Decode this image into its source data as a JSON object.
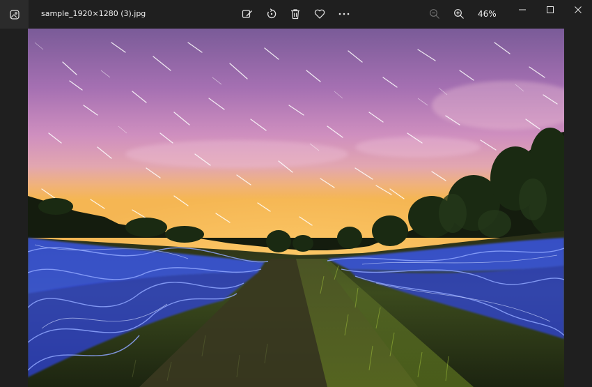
{
  "window": {
    "file_name": "sample_1920×1280 (3).jpg",
    "zoom": "46%"
  },
  "toolbar": {
    "icons": [
      "edit-image-icon",
      "rotate-icon",
      "delete-icon",
      "favorite-heart-icon",
      "more-options-icon"
    ],
    "zoom_controls": [
      "zoom-out-icon",
      "zoom-in-icon"
    ]
  },
  "window_controls": [
    "minimize-icon",
    "maximize-icon",
    "close-icon"
  ],
  "photo": {
    "subject": "star trails over field with blue light painting",
    "colors": {
      "sky_top": "#7b5a9a",
      "sky_mid": "#c88bc0",
      "horizon": "#f3b35a",
      "trees": "#16200f",
      "grass": "#3d4a1c",
      "light": "#3a5cff"
    }
  }
}
